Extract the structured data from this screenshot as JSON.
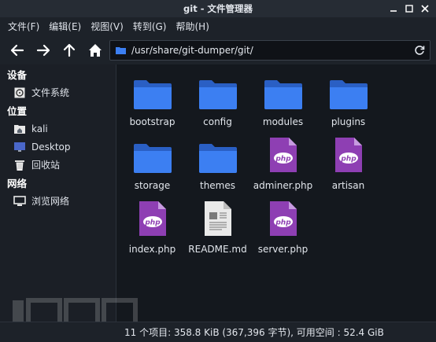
{
  "window": {
    "title": "git - 文件管理器"
  },
  "menu": [
    "文件(F)",
    "编辑(E)",
    "视图(V)",
    "转到(G)",
    "帮助(H)"
  ],
  "toolbar": {
    "path": "/usr/share/git-dumper/git/"
  },
  "sidebar": {
    "sections": [
      {
        "label": "设备",
        "items": [
          {
            "label": "文件系统",
            "icon": "drive-icon"
          }
        ]
      },
      {
        "label": "位置",
        "items": [
          {
            "label": "kali",
            "icon": "home-folder-icon"
          },
          {
            "label": "Desktop",
            "icon": "desktop-icon"
          },
          {
            "label": "回收站",
            "icon": "trash-icon"
          }
        ]
      },
      {
        "label": "网络",
        "items": [
          {
            "label": "浏览网络",
            "icon": "network-icon"
          }
        ]
      }
    ]
  },
  "files": [
    {
      "name": "bootstrap",
      "icon": "folder-icon"
    },
    {
      "name": "config",
      "icon": "folder-icon"
    },
    {
      "name": "modules",
      "icon": "folder-icon"
    },
    {
      "name": "plugins",
      "icon": "folder-icon"
    },
    {
      "name": "storage",
      "icon": "folder-icon"
    },
    {
      "name": "themes",
      "icon": "folder-icon"
    },
    {
      "name": "adminer.php",
      "icon": "php-file-icon"
    },
    {
      "name": "artisan",
      "icon": "php-file-icon"
    },
    {
      "name": "index.php",
      "icon": "php-file-icon"
    },
    {
      "name": "README.md",
      "icon": "text-file-icon"
    },
    {
      "name": "server.php",
      "icon": "php-file-icon"
    }
  ],
  "status": {
    "text": "11 个项目: 358.8 KiB (367,396 字节), 可用空间 : 52.4 GiB"
  },
  "colors": {
    "folder": "#3c7ff2",
    "php": "#8e3fb3",
    "background": "#14181e"
  }
}
